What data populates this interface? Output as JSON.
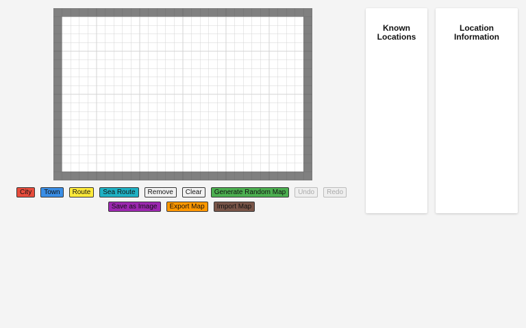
{
  "map": {
    "cols": 30,
    "rows": 20,
    "border_color": "#808080",
    "grid_line_color": "#d3d3d3",
    "cell_fill": "#ffffff"
  },
  "toolbar": {
    "row1": [
      {
        "id": "city",
        "label": "City",
        "color": "#e74c3c",
        "enabled": true
      },
      {
        "id": "town",
        "label": "Town",
        "color": "#3a8ee6",
        "enabled": true
      },
      {
        "id": "route",
        "label": "Route",
        "color": "#ffeb3b",
        "enabled": true
      },
      {
        "id": "sea-route",
        "label": "Sea Route",
        "color": "#1fb1c4",
        "enabled": true
      },
      {
        "id": "remove",
        "label": "Remove",
        "color": "#f2f2f2",
        "enabled": true
      },
      {
        "id": "clear",
        "label": "Clear",
        "color": "#f2f2f2",
        "enabled": true
      },
      {
        "id": "generate-random-map",
        "label": "Generate Random Map",
        "color": "#4caf50",
        "enabled": true
      },
      {
        "id": "undo",
        "label": "Undo",
        "color": "#efefef",
        "enabled": false
      },
      {
        "id": "redo",
        "label": "Redo",
        "color": "#efefef",
        "enabled": false
      }
    ],
    "row2": [
      {
        "id": "save-as-image",
        "label": "Save as Image",
        "color": "#9c27b0",
        "enabled": true
      },
      {
        "id": "export-map",
        "label": "Export Map",
        "color": "#ff9800",
        "enabled": true
      },
      {
        "id": "import-map",
        "label": "Import Map",
        "color": "#795548",
        "enabled": true
      }
    ]
  },
  "panels": {
    "known_locations": {
      "title_line1": "Known",
      "title_line2": "Locations"
    },
    "location_information": {
      "title_line1": "Location",
      "title_line2": "Information"
    }
  }
}
